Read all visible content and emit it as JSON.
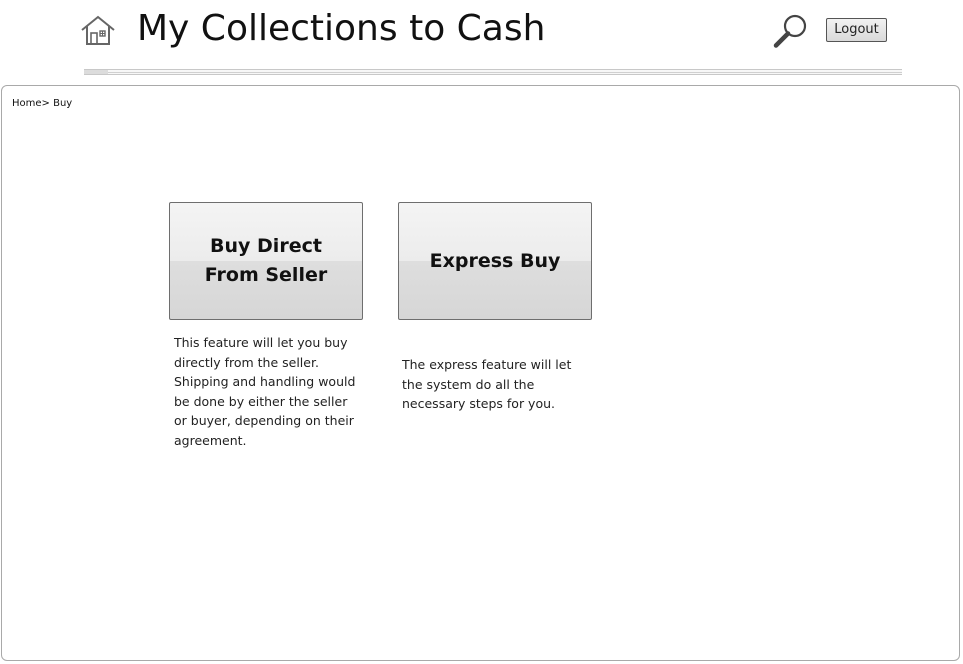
{
  "header": {
    "title": "My Collections to Cash",
    "home_icon": "home-icon",
    "search_icon": "search-icon",
    "logout_label": "Logout"
  },
  "breadcrumb": {
    "home": "Home",
    "separator": ">",
    "current": "Buy"
  },
  "options": [
    {
      "label_line1": "Buy Direct",
      "label_line2": "From Seller",
      "description": "This feature will let you buy directly from the seller. Shipping and handling would be done by either the seller or buyer, depending on their agreement."
    },
    {
      "label": "Express Buy",
      "description": "The express feature will let the system do all the necessary steps for you."
    }
  ],
  "colors": {
    "panel_border": "#a9a9a9",
    "button_border": "#6e6e6e",
    "text": "#111111"
  }
}
